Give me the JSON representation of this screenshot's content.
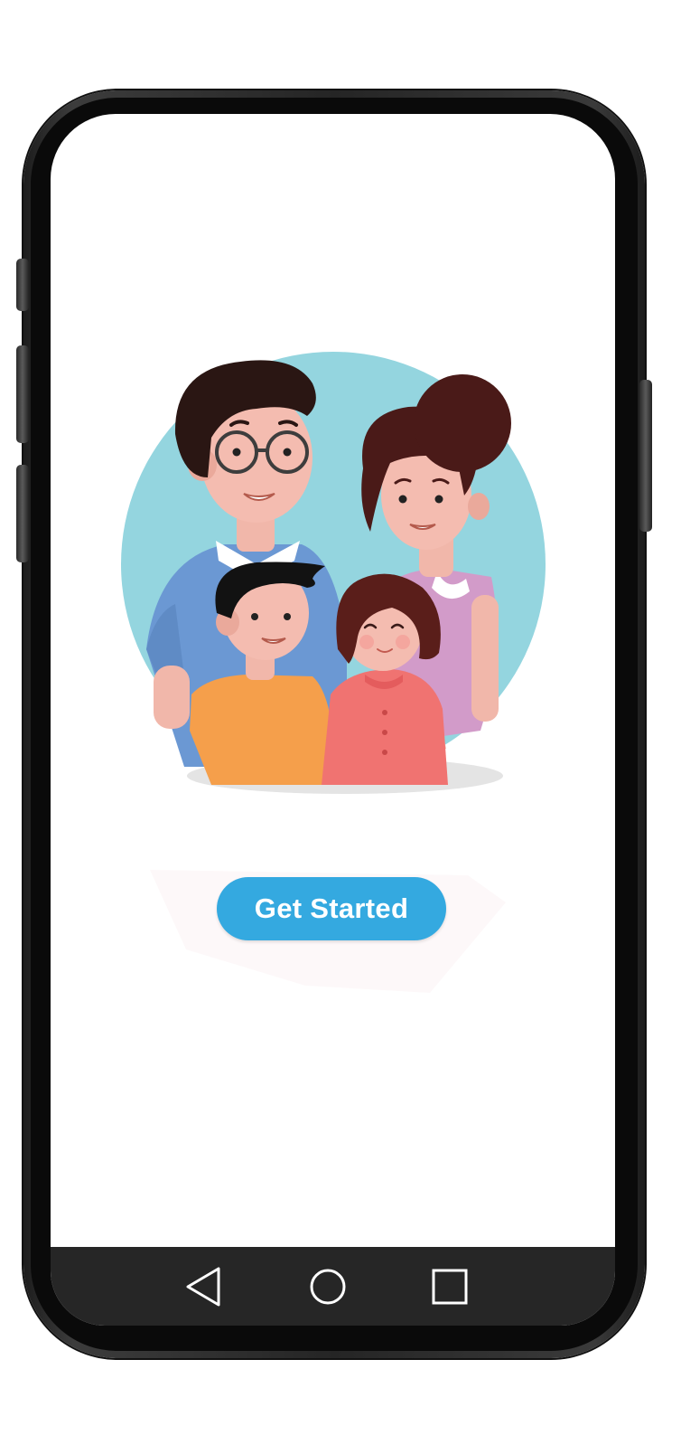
{
  "onboarding": {
    "cta_label": "Get Started"
  },
  "navigation": {
    "back": "back-icon",
    "home": "home-icon",
    "recents": "recents-icon"
  },
  "colors": {
    "accent": "#34a9e0",
    "illustration_background": "#94d5df",
    "nav_bar": "#262626"
  }
}
